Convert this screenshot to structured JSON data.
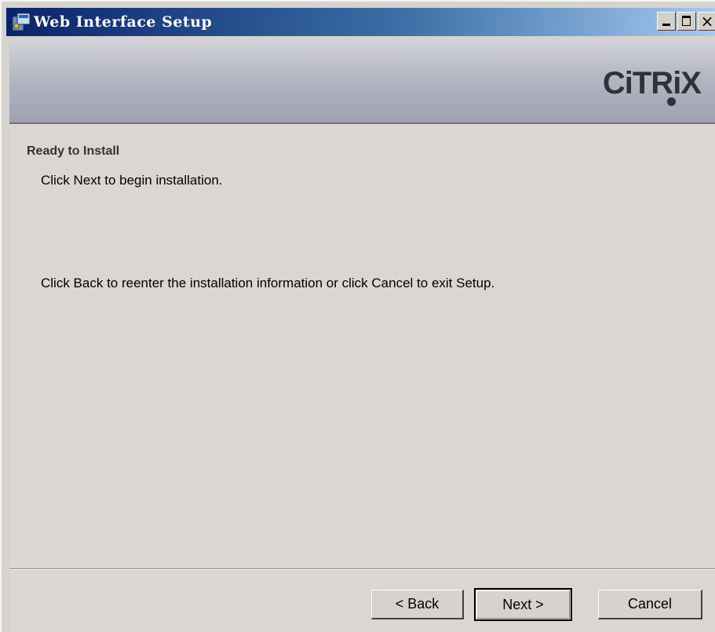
{
  "window": {
    "title": "Web Interface Setup",
    "controls": {
      "minimize_icon": "minimize-icon",
      "maximize_icon": "maximize-icon",
      "close_glyph": "×"
    }
  },
  "banner": {
    "logo_text": "CiTRiX"
  },
  "content": {
    "heading": "Ready to Install",
    "line1": "Click Next to begin installation.",
    "line2": "Click Back to reenter the installation information or click Cancel to exit Setup."
  },
  "footer": {
    "back_label": "< Back",
    "next_label": "Next >",
    "cancel_label": "Cancel"
  },
  "colors": {
    "titlebar_start": "#0a246a",
    "titlebar_end": "#a6caf0",
    "dialog_bg": "#dcd6d3"
  }
}
